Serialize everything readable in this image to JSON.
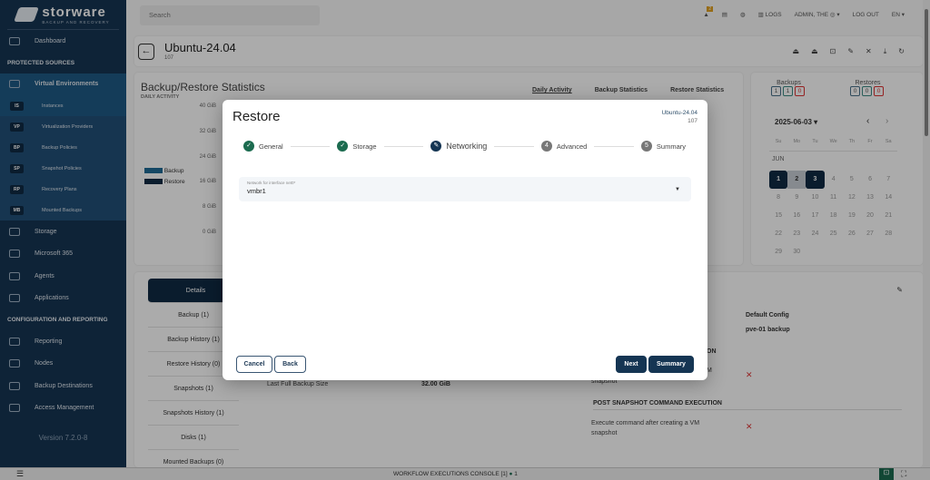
{
  "brand": {
    "name": "storware",
    "tagline": "BACKUP AND RECOVERY"
  },
  "sidebar": {
    "dashboard": "Dashboard",
    "protected_header": "PROTECTED SOURCES",
    "virtual_env": "Virtual Environments",
    "sub_items": [
      {
        "badge": "IS",
        "label": "Instances"
      },
      {
        "badge": "VP",
        "label": "Virtualization Providers"
      },
      {
        "badge": "BP",
        "label": "Backup Policies"
      },
      {
        "badge": "SP",
        "label": "Snapshot Policies"
      },
      {
        "badge": "RP",
        "label": "Recovery Plans"
      },
      {
        "badge": "MB",
        "label": "Mounted Backups"
      }
    ],
    "items": [
      "Storage",
      "Microsoft 365",
      "Agents",
      "Applications"
    ],
    "config_header": "CONFIGURATION AND REPORTING",
    "config_items": [
      "Reporting",
      "Nodes",
      "Backup Destinations",
      "Access Management"
    ],
    "version": "Version 7.2.0-8"
  },
  "topbar": {
    "search_placeholder": "Search",
    "alert_count": "2",
    "logs": "LOGS",
    "user": "ADMIN, THE",
    "logout": "LOG OUT",
    "lang": "EN"
  },
  "header": {
    "title": "Ubuntu-24.04",
    "id": "107"
  },
  "stats": {
    "title": "Backup/Restore Statistics",
    "subtitle": "DAILY ACTIVITY",
    "tabs": [
      "Daily Activity",
      "Backup Statistics",
      "Restore Statistics"
    ],
    "legend": [
      "Backup",
      "Restore"
    ],
    "y_ticks": [
      "40 GiB",
      "32 GiB",
      "24 GiB",
      "16 GiB",
      "8 GiB",
      "0 GiB"
    ]
  },
  "calendar": {
    "backups_label": "Backups",
    "backups": [
      "1",
      "1",
      "0"
    ],
    "restores_label": "Restores",
    "restores": [
      "0",
      "0",
      "0"
    ],
    "date": "2025-06-03",
    "weekdays": [
      "Su",
      "Mo",
      "Tu",
      "We",
      "Th",
      "Fr",
      "Sa"
    ],
    "month": "JUN",
    "days": [
      "1",
      "2",
      "3",
      "4",
      "5",
      "6",
      "7",
      "8",
      "9",
      "10",
      "11",
      "12",
      "13",
      "14",
      "15",
      "16",
      "17",
      "18",
      "19",
      "20",
      "21",
      "22",
      "23",
      "24",
      "25",
      "26",
      "27",
      "28",
      "29",
      "30"
    ]
  },
  "details": {
    "tabs": [
      "Details",
      "Backup (1)",
      "Backup History (1)",
      "Restore History (0)",
      "Snapshots (1)",
      "Snapshots History (1)",
      "Disks (1)",
      "Mounted Backups (0)"
    ],
    "last_full_label": "Last Full Backup Size",
    "last_full_value": "32.00 GiB",
    "config": "Default Config",
    "policy": "pve-01 backup",
    "pre_header_tail": "ON",
    "pre_text_tail": "M",
    "pre_text2": "snapshot",
    "post_header": "POST SNAPSHOT COMMAND EXECUTION",
    "post_text": "Execute command after creating a VM snapshot"
  },
  "bottom": {
    "console": "WORKFLOW EXECUTIONS CONSOLE [1]",
    "running": "1"
  },
  "modal": {
    "title": "Restore",
    "vm": "Ubuntu-24.04",
    "vm_id": "107",
    "steps": [
      {
        "n": "1",
        "label": "General"
      },
      {
        "n": "2",
        "label": "Storage"
      },
      {
        "n": "3",
        "label": "Networking"
      },
      {
        "n": "4",
        "label": "Advanced"
      },
      {
        "n": "5",
        "label": "Summary"
      }
    ],
    "field_label": "Network for interface net0*",
    "field_value": "vmbr1",
    "cancel": "Cancel",
    "back": "Back",
    "next": "Next",
    "summary": "Summary"
  }
}
